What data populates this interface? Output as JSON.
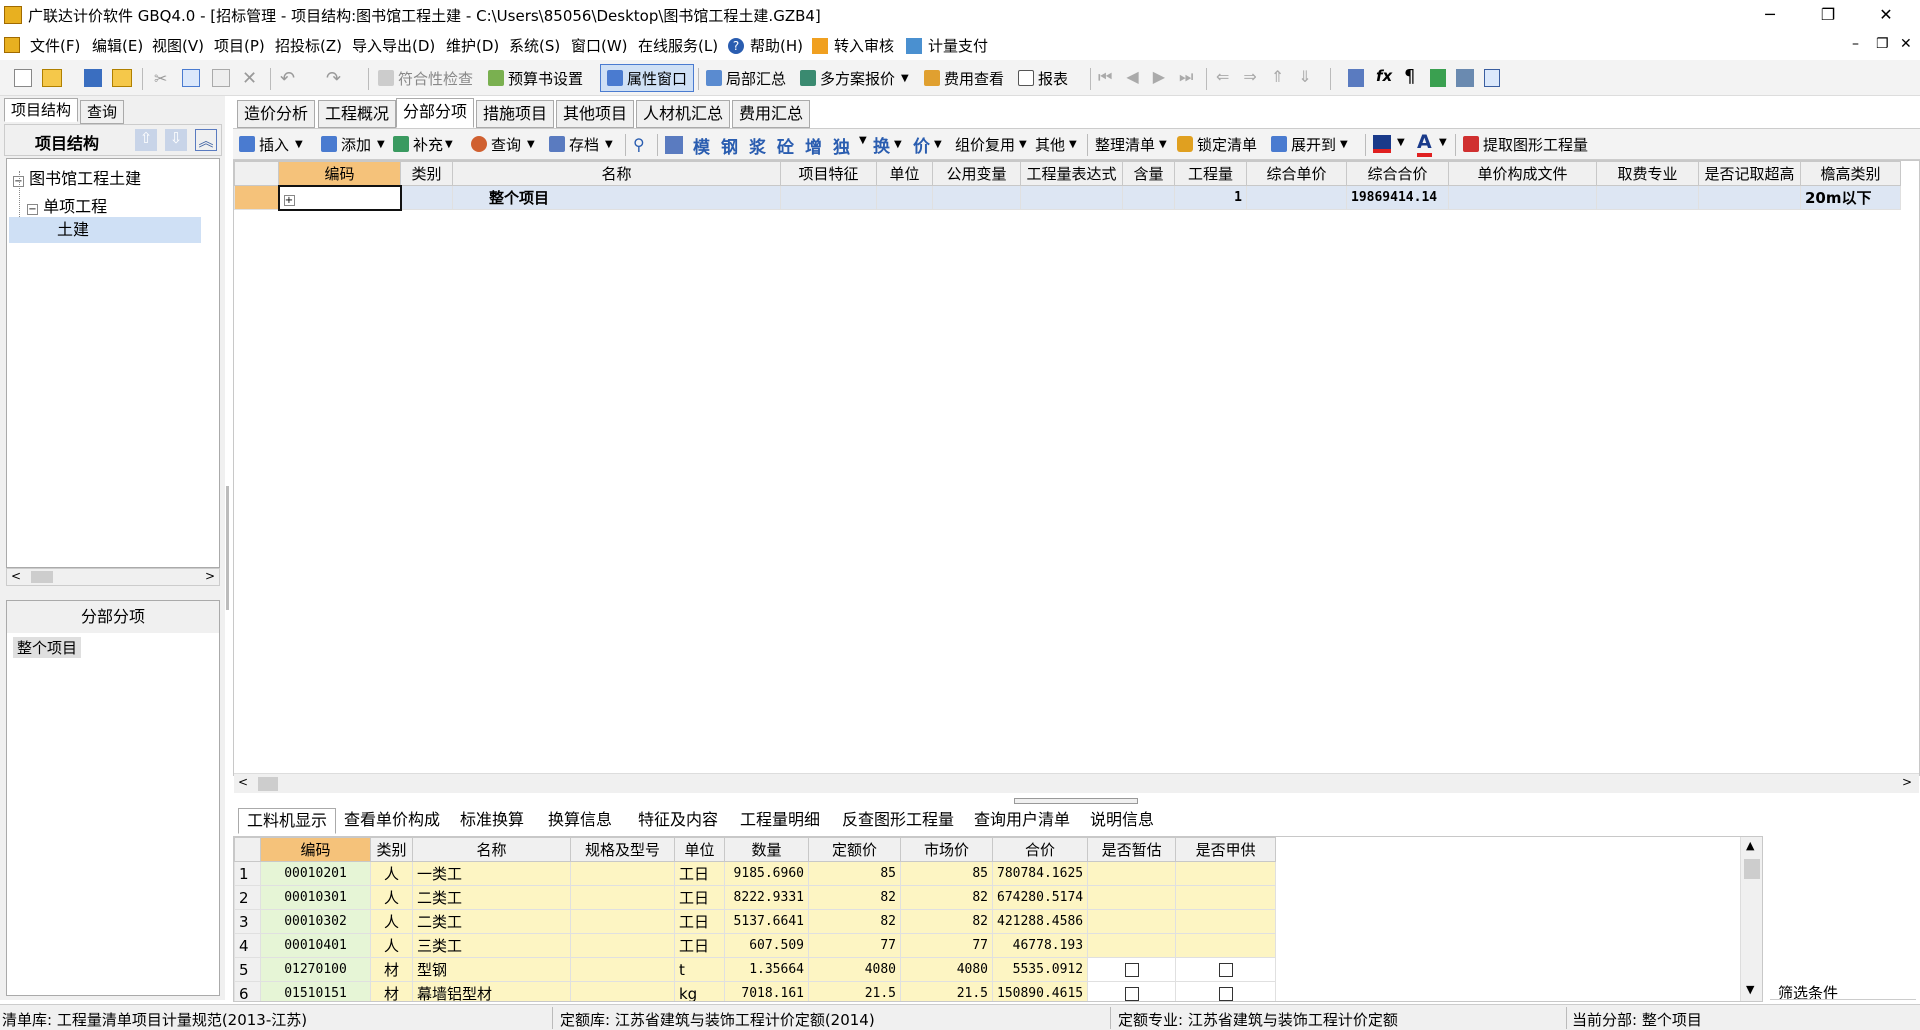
{
  "window": {
    "title": "广联达计价软件 GBQ4.0 - [招标管理 - 项目结构:图书馆工程土建 - C:\\Users\\85056\\Desktop\\图书馆工程土建.GZB4]",
    "minimize": "─",
    "restore": "❐",
    "close": "✕"
  },
  "menu": {
    "items": [
      "文件(F)",
      "编辑(E)",
      "视图(V)",
      "项目(P)",
      "招投标(Z)",
      "导入导出(D)",
      "维护(D)",
      "系统(S)",
      "窗口(W)",
      "在线服务(L)",
      "帮助(H)",
      "转入审核",
      "计量支付"
    ]
  },
  "toolbar1": {
    "compliance_check": "符合性检查",
    "budget_settings": "预算书设置",
    "property_window": "属性窗口",
    "partial_summary": "局部汇总",
    "multi_plan_quote": "多方案报价",
    "fee_view": "费用查看",
    "report": "报表"
  },
  "left": {
    "tab_structure": "项目结构",
    "tab_query": "查询",
    "header": "项目结构",
    "tree": {
      "root": "图书馆工程土建",
      "child": "单项工程",
      "leaf": "土建"
    },
    "division_title": "分部分项",
    "division_item": "整个项目"
  },
  "subtabs": [
    "造价分析",
    "工程概况",
    "分部分项",
    "措施项目",
    "其他项目",
    "人材机汇总",
    "费用汇总"
  ],
  "toolbar2": {
    "insert": "插入",
    "add": "添加",
    "supplement": "补充",
    "query": "查询",
    "archive": "存档",
    "glyph_chars": [
      "模",
      "钢",
      "浆",
      "砼",
      "增",
      "独"
    ],
    "swap": "换",
    "price": "价",
    "group_reuse": "组价复用",
    "other": "其他",
    "organize_list": "整理清单",
    "lock_list": "锁定清单",
    "expand_to": "展开到",
    "font_color_a": "A",
    "extract_quantity": "提取图形工程量"
  },
  "main_grid": {
    "headers": [
      "编码",
      "类别",
      "名称",
      "项目特征",
      "单位",
      "公用变量",
      "工程量表达式",
      "含量",
      "工程量",
      "综合单价",
      "综合合价",
      "单价构成文件",
      "取费专业",
      "是否记取超高",
      "檐高类别"
    ],
    "row": {
      "expand": "+",
      "name": "整个项目",
      "quantity": "1",
      "total_price": "19869414.14",
      "eave_height": "20m以下"
    }
  },
  "bottom_tabs": [
    "工料机显示",
    "查看单价构成",
    "标准换算",
    "换算信息",
    "特征及内容",
    "工程量明细",
    "反查图形工程量",
    "查询用户清单",
    "说明信息"
  ],
  "material_grid": {
    "headers": [
      "编码",
      "类别",
      "名称",
      "规格及型号",
      "单位",
      "数量",
      "定额价",
      "市场价",
      "合价",
      "是否暂估",
      "是否甲供"
    ],
    "rows": [
      {
        "no": "1",
        "code": "00010201",
        "type": "人",
        "name": "一类工",
        "spec": "",
        "unit": "工日",
        "qty": "9185.6960",
        "quota": "85",
        "market": "85",
        "total": "780784.1625",
        "est": false,
        "supply": false
      },
      {
        "no": "2",
        "code": "00010301",
        "type": "人",
        "name": "二类工",
        "spec": "",
        "unit": "工日",
        "qty": "8222.9331",
        "quota": "82",
        "market": "82",
        "total": "674280.5174",
        "est": false,
        "supply": false
      },
      {
        "no": "3",
        "code": "00010302",
        "type": "人",
        "name": "二类工",
        "spec": "",
        "unit": "工日",
        "qty": "5137.6641",
        "quota": "82",
        "market": "82",
        "total": "421288.4586",
        "est": false,
        "supply": false
      },
      {
        "no": "4",
        "code": "00010401",
        "type": "人",
        "name": "三类工",
        "spec": "",
        "unit": "工日",
        "qty": "607.509",
        "quota": "77",
        "market": "77",
        "total": "46778.193",
        "est": false,
        "supply": false
      },
      {
        "no": "5",
        "code": "01270100",
        "type": "材",
        "name": "型钢",
        "spec": "",
        "unit": "t",
        "qty": "1.35664",
        "quota": "4080",
        "market": "4080",
        "total": "5535.0912",
        "est": true,
        "supply": true
      },
      {
        "no": "6",
        "code": "01510151",
        "type": "材",
        "name": "幕墙铝型材",
        "spec": "",
        "unit": "kg",
        "qty": "7018.161",
        "quota": "21.5",
        "market": "21.5",
        "total": "150890.4615",
        "est": true,
        "supply": true
      }
    ]
  },
  "filter_label": "筛选条件",
  "statusbar": {
    "list_lib": "清单库:  工程量清单项目计量规范(2013-江苏)",
    "quota_lib": "定额库:  江苏省建筑与装饰工程计价定额(2014)",
    "quota_major": "定额专业:  江苏省建筑与装饰工程计价定额",
    "current_division": "当前分部:  整个项目"
  },
  "colors": {
    "header_orange": "#f5c27a",
    "row_selected": "#dde6f3",
    "row_yellow": "#fdf5c3",
    "tree_select": "#cfe0f5"
  }
}
